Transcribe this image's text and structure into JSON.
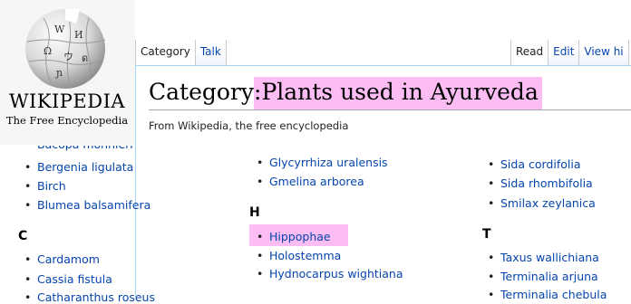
{
  "logo": {
    "wordmark": "WIKIPEDIA",
    "tagline": "The Free Encyclopedia",
    "icon": "puzzle-globe-icon"
  },
  "tabs": {
    "category": "Category",
    "talk": "Talk",
    "read": "Read",
    "edit": "Edit",
    "view_history": "View hi"
  },
  "page": {
    "title_prefix": "Category:",
    "title_name": "Plants used in Ayurveda",
    "tagline": "From Wikipedia, the free encyclopedia"
  },
  "col1": {
    "cut_item": "Bacopa monnieri",
    "items": [
      "Bergenia ligulata",
      "Birch",
      "Blumea balsamifera"
    ],
    "letter_c": "C",
    "items_c": [
      "Cardamom",
      "Cassia fistula",
      "Catharanthus roseus"
    ]
  },
  "col2": {
    "items": [
      "Glycyrrhiza uralensis",
      "Gmelina arborea"
    ],
    "letter_h": "H",
    "items_h": [
      "Hippophae",
      "Holostemma",
      "Hydnocarpus wightiana"
    ]
  },
  "col3": {
    "items": [
      "Sida cordifolia",
      "Sida rhombifolia",
      "Smilax zeylanica"
    ],
    "letter_t": "T",
    "items_t": [
      "Taxus wallichiana",
      "Terminalia arjuna",
      "Terminalia chebula"
    ]
  },
  "colors": {
    "highlight": "#fbbdf4",
    "link": "#0645ad"
  }
}
